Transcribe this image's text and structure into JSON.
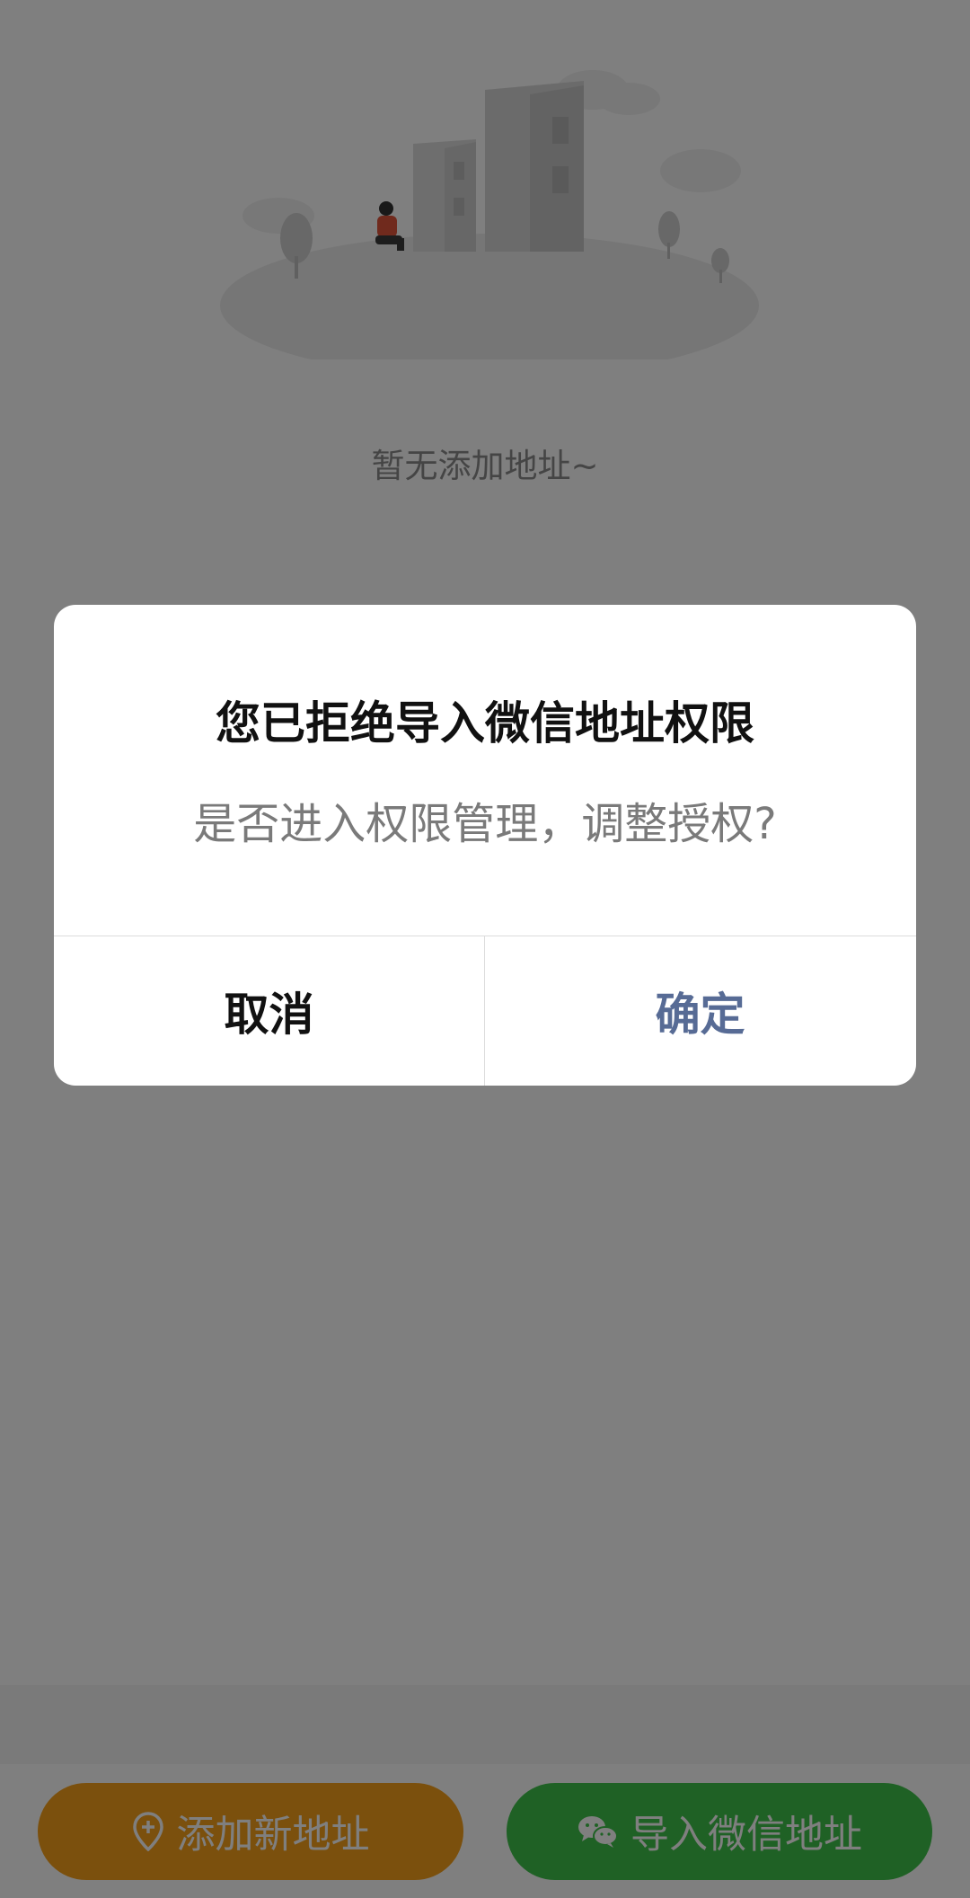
{
  "empty_state": {
    "message": "暂无添加地址~"
  },
  "bottom_bar": {
    "add_label": "添加新地址",
    "add_color": "#f7a01b",
    "import_label": "导入微信地址",
    "import_color": "#3ec24a"
  },
  "dialog": {
    "title": "您已拒绝导入微信地址权限",
    "message": "是否进入权限管理，调整授权?",
    "cancel_label": "取消",
    "confirm_label": "确定",
    "confirm_color": "#576b95"
  },
  "icons": {
    "add_icon": "location-plus-icon",
    "import_icon": "wechat-icon"
  }
}
